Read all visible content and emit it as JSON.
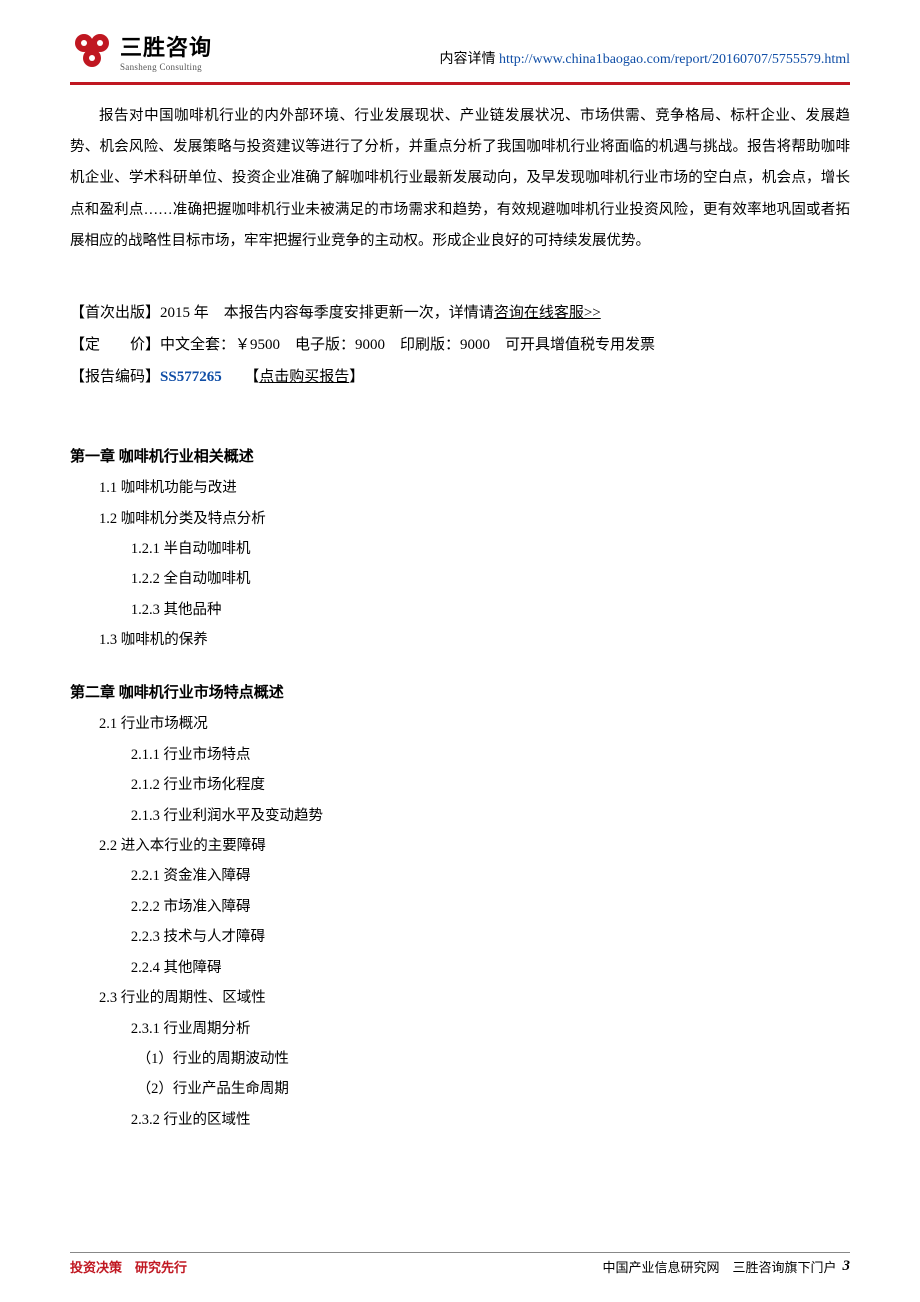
{
  "header": {
    "logo_cn": "三胜咨询",
    "logo_en": "Sansheng Consulting",
    "prefix": "内容详情",
    "url": "http://www.china1baogao.com/report/20160707/5755579.html"
  },
  "intro_paragraph": "报告对中国咖啡机行业的内外部环境、行业发展现状、产业链发展状况、市场供需、竞争格局、标杆企业、发展趋势、机会风险、发展策略与投资建议等进行了分析，并重点分析了我国咖啡机行业将面临的机遇与挑战。报告将帮助咖啡机企业、学术科研单位、投资企业准确了解咖啡机行业最新发展动向，及早发现咖啡机行业市场的空白点，机会点，增长点和盈利点……准确把握咖啡机行业未被满足的市场需求和趋势，有效规避咖啡机行业投资风险，更有效率地巩固或者拓展相应的战略性目标市场，牢牢把握行业竞争的主动权。形成企业良好的可持续发展优势。",
  "meta": {
    "first_pub_label": "【首次出版】",
    "first_pub_value": "2015 年",
    "first_pub_note_prefix": "本报告内容每季度安排更新一次，详情请",
    "first_pub_note_link": "咨询在线客服>>",
    "price_label_open": "【定",
    "price_label_close": "价】",
    "price_value": "中文全套：￥9500　电子版：9000　印刷版：9000　可开具增值税专用发票",
    "code_label": "【报告编码】",
    "code_value": "SS577265",
    "buy_open": "【",
    "buy_text": "点击购买报告",
    "buy_close": "】"
  },
  "toc": {
    "ch1": {
      "title": "第一章 咖啡机行业相关概述",
      "s1_1": "1.1 咖啡机功能与改进",
      "s1_2": "1.2 咖啡机分类及特点分析",
      "s1_2_1": "1.2.1 半自动咖啡机",
      "s1_2_2": "1.2.2 全自动咖啡机",
      "s1_2_3": "1.2.3 其他品种",
      "s1_3": "1.3 咖啡机的保养"
    },
    "ch2": {
      "title": "第二章 咖啡机行业市场特点概述",
      "s2_1": "2.1 行业市场概况",
      "s2_1_1": "2.1.1 行业市场特点",
      "s2_1_2": "2.1.2 行业市场化程度",
      "s2_1_3": "2.1.3 行业利润水平及变动趋势",
      "s2_2": "2.2 进入本行业的主要障碍",
      "s2_2_1": "2.2.1 资金准入障碍",
      "s2_2_2": "2.2.2 市场准入障碍",
      "s2_2_3": "2.2.3 技术与人才障碍",
      "s2_2_4": "2.2.4 其他障碍",
      "s2_3": "2.3 行业的周期性、区域性",
      "s2_3_1": "2.3.1 行业周期分析",
      "s2_3_1a": "（1）行业的周期波动性",
      "s2_3_1b": "（2）行业产品生命周期",
      "s2_3_2": "2.3.2 行业的区域性"
    }
  },
  "footer": {
    "left": "投资决策　研究先行",
    "right": "中国产业信息研究网　三胜咨询旗下门户",
    "page": "3"
  }
}
